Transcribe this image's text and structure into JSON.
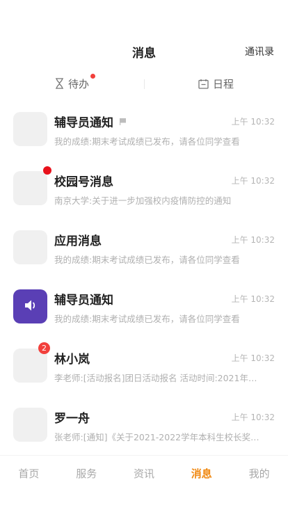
{
  "header": {
    "title": "消息",
    "contacts_label": "通讯录"
  },
  "tabs": [
    {
      "label": "待办",
      "icon": "hourglass-icon",
      "has_dot": true
    },
    {
      "label": "日程",
      "icon": "calendar-icon",
      "has_dot": false
    }
  ],
  "messages": [
    {
      "name": "辅导员通知",
      "time": "上午 10:32",
      "preview": "我的成绩:期末考试成绩已发布，请各位同学查看",
      "flag_icon": "pin-flag-icon"
    },
    {
      "name": "校园号消息",
      "time": "上午 10:32",
      "preview": "南京大学:关于进一步加强校内疫情防控的通知"
    },
    {
      "name": "应用消息",
      "time": "上午 10:32",
      "preview": "我的成绩:期末考试成绩已发布，请各位同学查看"
    },
    {
      "name": "辅导员通知",
      "time": "上午 10:32",
      "preview": "我的成绩:期末考试成绩已发布，请各位同学查看",
      "avatar_icon": "speaker-icon"
    },
    {
      "name": "林小岚",
      "time": "上午 10:32",
      "preview": "李老师:[活动报名]团日活动报名 活动时间:2021年…",
      "badge": "2"
    },
    {
      "name": "罗一舟",
      "time": "上午 10:32",
      "preview": "张老师:[通知]《关于2021-2022学年本科生校长奖…"
    }
  ],
  "tabbar": [
    {
      "label": "首页"
    },
    {
      "label": "服务"
    },
    {
      "label": "资讯"
    },
    {
      "label": "消息",
      "active": true
    },
    {
      "label": "我的"
    }
  ],
  "colors": {
    "accent": "#f08a14",
    "badge_red": "#f2403c",
    "purple_avatar": "#5a3fb5"
  }
}
